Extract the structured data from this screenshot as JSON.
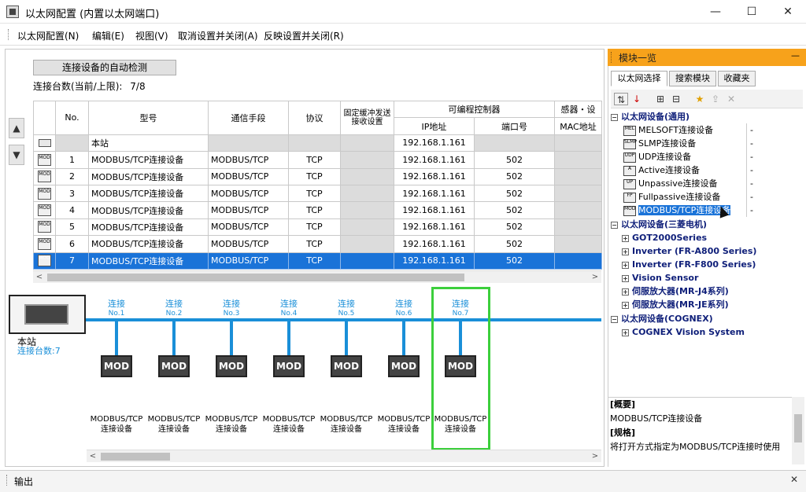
{
  "window": {
    "title": "以太网配置 (内置以太网端口)",
    "min": "—",
    "max": "☐",
    "close": "✕"
  },
  "menu": [
    "以太网配置(N)",
    "编辑(E)",
    "视图(V)",
    "取消设置并关闭(A)",
    "反映设置并关闭(R)"
  ],
  "main": {
    "detect_button": "连接设备的自动检测",
    "count_label": "连接台数(当前/上限):",
    "count_value": "7/8",
    "headers": {
      "no": "No.",
      "model": "型号",
      "comm": "通信手段",
      "protocol": "协议",
      "fixed_buffer": "固定缓冲发送接收设置",
      "plc": "可编程控制器",
      "ip": "IP地址",
      "port": "端口号",
      "sensor": "感器・设",
      "mac": "MAC地址"
    },
    "host_row": {
      "name": "本站",
      "ip": "192.168.1.161"
    },
    "rows": [
      {
        "no": "1",
        "model": "MODBUS/TCP连接设备",
        "comm": "MODBUS/TCP",
        "protocol": "TCP",
        "ip": "192.168.1.161",
        "port": "502"
      },
      {
        "no": "2",
        "model": "MODBUS/TCP连接设备",
        "comm": "MODBUS/TCP",
        "protocol": "TCP",
        "ip": "192.168.1.161",
        "port": "502"
      },
      {
        "no": "3",
        "model": "MODBUS/TCP连接设备",
        "comm": "MODBUS/TCP",
        "protocol": "TCP",
        "ip": "192.168.1.161",
        "port": "502"
      },
      {
        "no": "4",
        "model": "MODBUS/TCP连接设备",
        "comm": "MODBUS/TCP",
        "protocol": "TCP",
        "ip": "192.168.1.161",
        "port": "502"
      },
      {
        "no": "5",
        "model": "MODBUS/TCP连接设备",
        "comm": "MODBUS/TCP",
        "protocol": "TCP",
        "ip": "192.168.1.161",
        "port": "502"
      },
      {
        "no": "6",
        "model": "MODBUS/TCP连接设备",
        "comm": "MODBUS/TCP",
        "protocol": "TCP",
        "ip": "192.168.1.161",
        "port": "502"
      },
      {
        "no": "7",
        "model": "MODBUS/TCP连接设备",
        "comm": "MODBUS/TCP",
        "protocol": "TCP",
        "ip": "192.168.1.161",
        "port": "502"
      }
    ],
    "up_arrow": "▲",
    "down_arrow": "▼"
  },
  "diagram": {
    "station_label": "本站",
    "station_count": "连接台数:7",
    "node_word": "连接",
    "nodes": [
      "No.1",
      "No.2",
      "No.3",
      "No.4",
      "No.5",
      "No.6",
      "No.7"
    ],
    "mod_label": "MOD",
    "caption_line1": "MODBUS/TCP",
    "caption_line2": "连接设备"
  },
  "module_list": {
    "title": "模块一览",
    "tabs": [
      "以太网选择",
      "搜索模块",
      "收藏夹"
    ],
    "categories": {
      "general": "以太网设备(通用)",
      "mitsubishi": "以太网设备(三菱电机)",
      "cognex": "以太网设备(COGNEX)"
    },
    "general_items": [
      {
        "name": "MELSOFT连接设备",
        "val": "-",
        "icon": "MEL"
      },
      {
        "name": "SLMP连接设备",
        "val": "-",
        "icon": "SLMP"
      },
      {
        "name": "UDP连接设备",
        "val": "-",
        "icon": "UDP"
      },
      {
        "name": "Active连接设备",
        "val": "-",
        "icon": "A"
      },
      {
        "name": "Unpassive连接设备",
        "val": "-",
        "icon": "UP"
      },
      {
        "name": "Fullpassive连接设备",
        "val": "-",
        "icon": "FP"
      },
      {
        "name": "MODBUS/TCP连接设备",
        "val": "-",
        "icon": "MOD"
      }
    ],
    "mitsubishi_items": [
      "GOT2000Series",
      "Inverter (FR-A800 Series)",
      "Inverter (FR-F800 Series)",
      "Vision Sensor",
      "伺服放大器(MR-J4系列)",
      "伺服放大器(MR-JE系列)"
    ],
    "cognex_items": [
      "COGNEX Vision System"
    ],
    "desc_overview_label": "[概要]",
    "desc_overview_text": "MODBUS/TCP连接设备",
    "desc_spec_label": "[规格]",
    "desc_spec_text": "将打开方式指定为MODBUS/TCP连接时使用"
  },
  "output": {
    "title": "输出",
    "close": "✕"
  },
  "colors": {
    "accent": "#1a73d8",
    "bus": "#1a8fd8",
    "panel_header": "#f7a21b",
    "selection_frame": "#3ccf3c"
  }
}
